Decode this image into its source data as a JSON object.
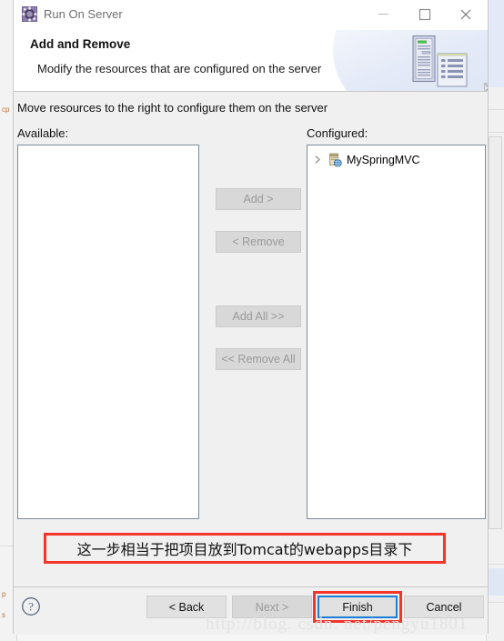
{
  "window": {
    "title": "Run On Server",
    "icon": "server-gear-icon",
    "minimize_label": "Minimize",
    "maximize_label": "Maximize",
    "close_label": "Close"
  },
  "header": {
    "title": "Add and Remove",
    "description": "Modify the resources that are configured on the server",
    "graphic": "server-and-document-icon"
  },
  "main": {
    "intro": "Move resources to the right to configure them on the server",
    "available_label": "Available:",
    "configured_label": "Configured:",
    "available_items": [],
    "configured_items": [
      {
        "label": "MySpringMVC",
        "icon": "web-module-icon",
        "expander": "chevron-right-icon"
      }
    ]
  },
  "transfer_buttons": [
    {
      "id": "add",
      "label": "Add >",
      "enabled": false
    },
    {
      "id": "remove",
      "label": "< Remove",
      "enabled": false
    },
    {
      "id": "add-all",
      "label": "Add All >>",
      "enabled": false
    },
    {
      "id": "remove-all",
      "label": "<< Remove All",
      "enabled": false
    }
  ],
  "annotation": {
    "note": "这一步相当于把项目放到Tomcat的webapps目录下",
    "box_color": "#f5352a"
  },
  "footer": {
    "help_label": "?",
    "back_label": "< Back",
    "next_label": "Next >",
    "finish_label": "Finish",
    "cancel_label": "Cancel",
    "focus_color": "#1a7fd4"
  },
  "watermark": {
    "text": "http://blog. csdn. net/pengyu1801"
  }
}
